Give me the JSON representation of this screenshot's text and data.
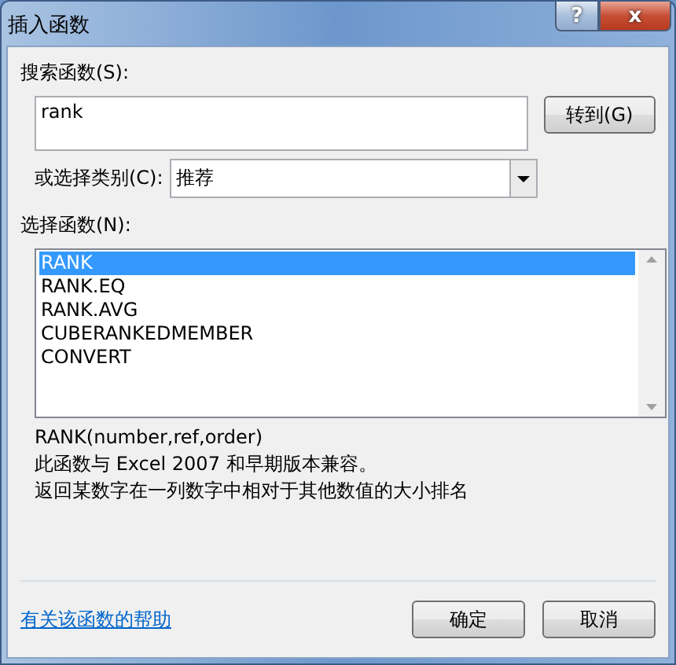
{
  "window": {
    "title": "插入函数",
    "buttons": [
      {
        "kind": "help",
        "label": "?"
      },
      {
        "kind": "close",
        "label": "x"
      }
    ]
  },
  "search": {
    "label": "搜索函数(S):",
    "value": "rank",
    "go_button": "转到(G)"
  },
  "category": {
    "label": "或选择类别(C):",
    "value": "推荐"
  },
  "functions": {
    "label": "选择函数(N):",
    "items": [
      {
        "name": "RANK",
        "selected": true
      },
      {
        "name": "RANK.EQ",
        "selected": false
      },
      {
        "name": "RANK.AVG",
        "selected": false
      },
      {
        "name": "CUBERANKEDMEMBER",
        "selected": false
      },
      {
        "name": "CONVERT",
        "selected": false
      }
    ]
  },
  "signature": "RANK(number,ref,order)",
  "description": [
    "此函数与 Excel 2007 和早期版本兼容。",
    "返回某数字在一列数字中相对于其他数值的大小排名"
  ],
  "help_link": "有关该函数的帮助",
  "buttons": [
    "确定",
    "取消"
  ]
}
